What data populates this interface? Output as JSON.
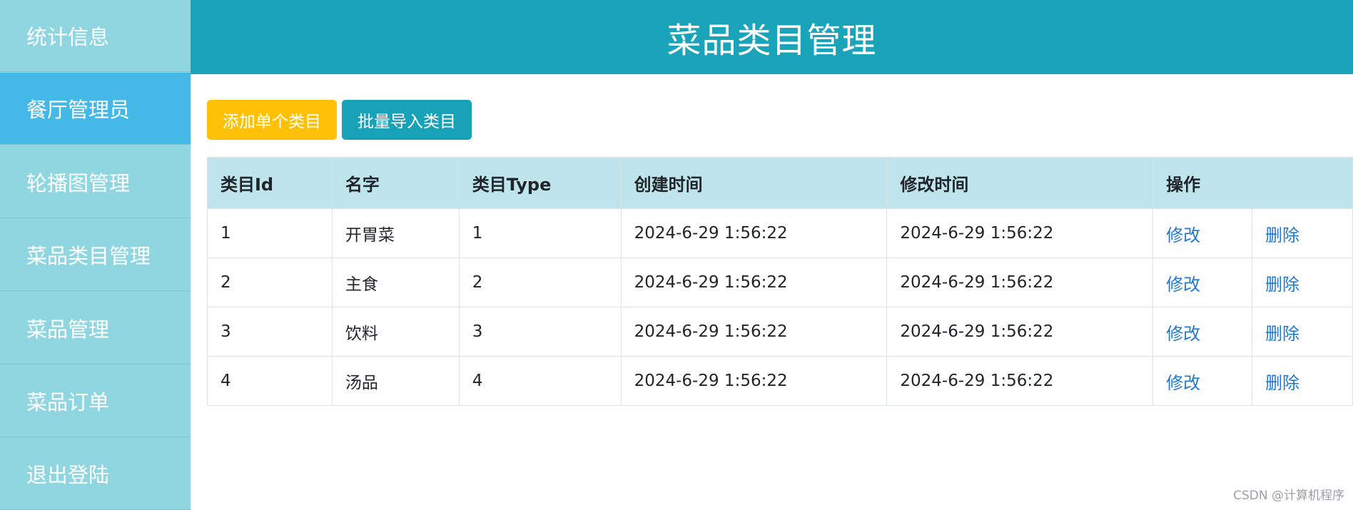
{
  "sidebar": {
    "items": [
      {
        "label": "统计信息"
      },
      {
        "label": "餐厅管理员"
      },
      {
        "label": "轮播图管理"
      },
      {
        "label": "菜品类目管理"
      },
      {
        "label": "菜品管理"
      },
      {
        "label": "菜品订单"
      },
      {
        "label": "退出登陆"
      }
    ]
  },
  "header": {
    "title": "菜品类目管理"
  },
  "toolbar": {
    "add_label": "添加单个类目",
    "import_label": "批量导入类目"
  },
  "table": {
    "headers": [
      "类目Id",
      "名字",
      "类目Type",
      "创建时间",
      "修改时间",
      "操作"
    ],
    "rows": [
      {
        "id": "1",
        "name": "开胃菜",
        "type": "1",
        "created": "2024-6-29 1:56:22",
        "modified": "2024-6-29 1:56:22",
        "edit": "修改",
        "delete": "删除"
      },
      {
        "id": "2",
        "name": "主食",
        "type": "2",
        "created": "2024-6-29 1:56:22",
        "modified": "2024-6-29 1:56:22",
        "edit": "修改",
        "delete": "删除"
      },
      {
        "id": "3",
        "name": "饮料",
        "type": "3",
        "created": "2024-6-29 1:56:22",
        "modified": "2024-6-29 1:56:22",
        "edit": "修改",
        "delete": "删除"
      },
      {
        "id": "4",
        "name": "汤品",
        "type": "4",
        "created": "2024-6-29 1:56:22",
        "modified": "2024-6-29 1:56:22",
        "edit": "修改",
        "delete": "删除"
      }
    ]
  },
  "watermark": "CSDN @计算机程序",
  "colors": {
    "sidebar": "#8fd6e1",
    "sidebar_active": "#44b8e6",
    "header": "#1aa4ba",
    "btn_add": "#ffc107",
    "btn_import": "#17a2b8",
    "table_header": "#bee5eb",
    "link": "#1f78d1"
  }
}
